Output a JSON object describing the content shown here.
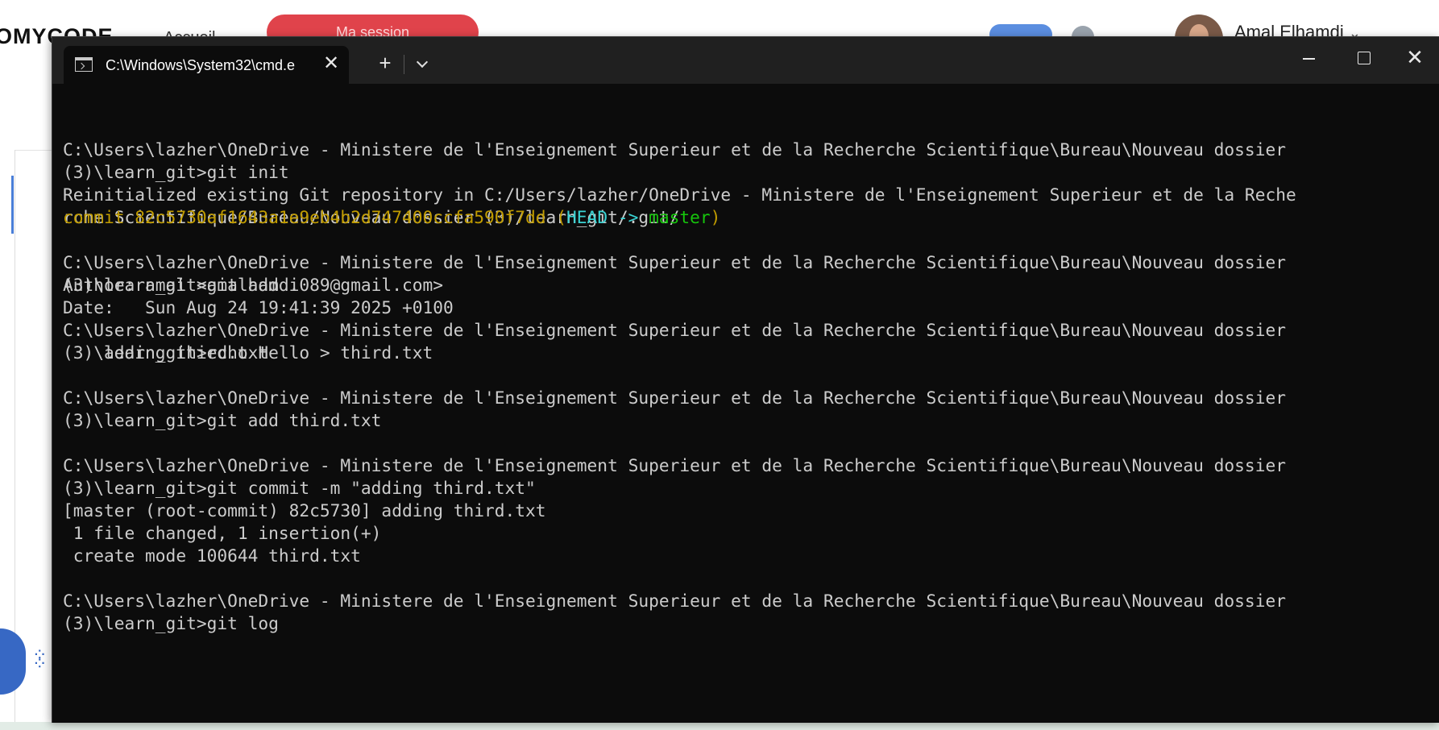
{
  "background": {
    "logo": "OMYCODE",
    "nav_item": "Accueil",
    "cta_button": "Ma session",
    "user_name": "Amal Elhamdi",
    "user_menu_chevron": "⌄"
  },
  "terminal": {
    "tab_title": "C:\\Windows\\System32\\cmd.e",
    "tab_close": "✕",
    "new_tab": "+",
    "close_window": "✕",
    "lines": [
      "C:\\Users\\lazher\\OneDrive - Ministere de l'Enseignement Superieur et de la Recherche Scientifique\\Bureau\\Nouveau dossier",
      "(3)\\learn_git>git init",
      "Reinitialized existing Git repository in C:/Users/lazher/OneDrive - Ministere de l'Enseignement Superieur et de la Reche",
      "rche Scientifique/Bureau/Nouveau dossier (3)/learn_git/.git/",
      "",
      "C:\\Users\\lazher\\OneDrive - Ministere de l'Enseignement Superieur et de la Recherche Scientifique\\Bureau\\Nouveau dossier",
      "(3)\\learn_git>git add .",
      "",
      "C:\\Users\\lazher\\OneDrive - Ministere de l'Enseignement Superieur et de la Recherche Scientifique\\Bureau\\Nouveau dossier",
      "(3)\\learn_git>echo Hello > third.txt",
      "",
      "C:\\Users\\lazher\\OneDrive - Ministere de l'Enseignement Superieur et de la Recherche Scientifique\\Bureau\\Nouveau dossier",
      "(3)\\learn_git>git add third.txt",
      "",
      "C:\\Users\\lazher\\OneDrive - Ministere de l'Enseignement Superieur et de la Recherche Scientifique\\Bureau\\Nouveau dossier",
      "(3)\\learn_git>git commit -m \"adding third.txt\"",
      "[master (root-commit) 82c5730] adding third.txt",
      " 1 file changed, 1 insertion(+)",
      " create mode 100644 third.txt",
      "",
      "C:\\Users\\lazher\\OneDrive - Ministere de l'Enseignement Superieur et de la Recherche Scientifique\\Bureau\\Nouveau dossier",
      "(3)\\learn_git>git log"
    ],
    "commit_line": {
      "prefix": "commit 82c5730af1643a1e9eb4b2d747400ccfa590f7dd",
      "open_paren": " (",
      "head": "HEAD ->",
      "space": " ",
      "branch": "master",
      "close_paren": ")"
    },
    "after_lines": [
      "Author: amal <amalhamdi089@gmail.com>",
      "Date:   Sun Aug 24 19:41:39 2025 +0100",
      "",
      "    adding third.txt"
    ],
    "colors": {
      "background": "#0c0c0c",
      "text": "#cccccc",
      "commit": "#c19c00",
      "head": "#3ad3d3",
      "branch": "#16c60c"
    }
  }
}
